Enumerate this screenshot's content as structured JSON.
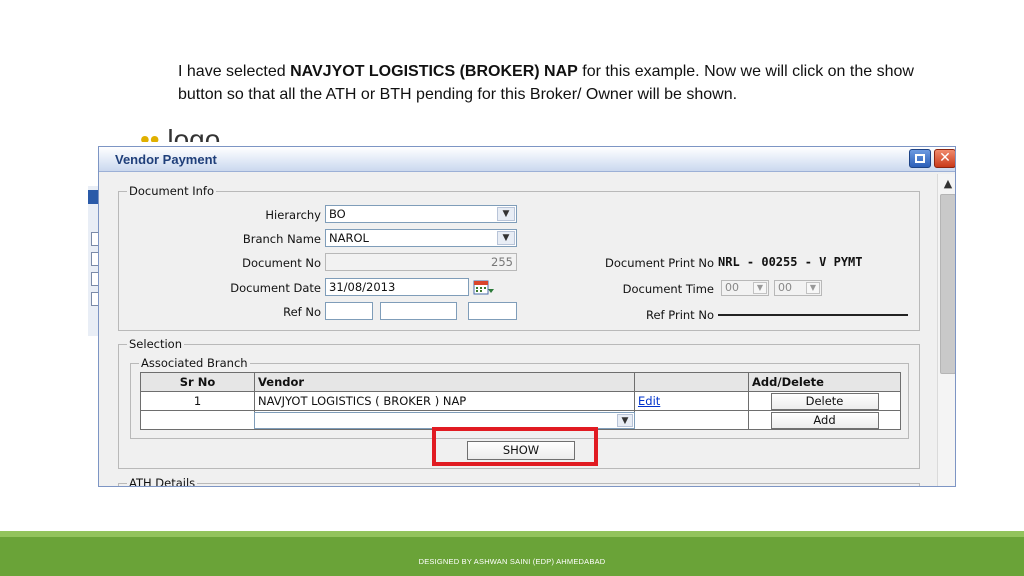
{
  "slide": {
    "caption_pre": "I have selected ",
    "caption_bold": "NAVJYOT LOGISTICS (BROKER) NAP",
    "caption_post": " for this example. Now we will click on the show button so that all the ATH or BTH pending for this Broker/ Owner will be shown.",
    "background_title_fragment": "logo",
    "footer": "DESIGNED BY ASHWAN SAINI (EDP) AHMEDABAD"
  },
  "window": {
    "title": "Vendor Payment"
  },
  "document_info": {
    "legend": "Document Info",
    "hierarchy_label": "Hierarchy",
    "hierarchy_value": "BO",
    "branch_label": "Branch Name",
    "branch_value": "NAROL",
    "docno_label": "Document No",
    "docno_value": "255",
    "docdate_label": "Document Date",
    "docdate_value": "31/08/2013",
    "refno_label": "Ref No",
    "print_no_label": "Document Print No",
    "print_no_value": "NRL - 00255 - V PYMT",
    "doc_time_label": "Document Time",
    "doc_time_hour": "00",
    "doc_time_min": "00",
    "ref_print_label": "Ref Print No"
  },
  "selection": {
    "legend": "Selection",
    "assoc_legend": "Associated Branch",
    "columns": [
      "Sr No",
      "Vendor",
      "",
      "Add/Delete"
    ],
    "rows": [
      {
        "sr": "1",
        "vendor": "NAVJYOT LOGISTICS ( BROKER ) NAP",
        "edit": "Edit",
        "action": "Delete"
      }
    ],
    "add_label": "Add",
    "show_label": "SHOW"
  },
  "ath": {
    "legend": "ATH Details"
  },
  "colors": {
    "highlight": "#e11b22",
    "footer_bg": "#6aa338",
    "title_text": "#1f3f7a"
  }
}
